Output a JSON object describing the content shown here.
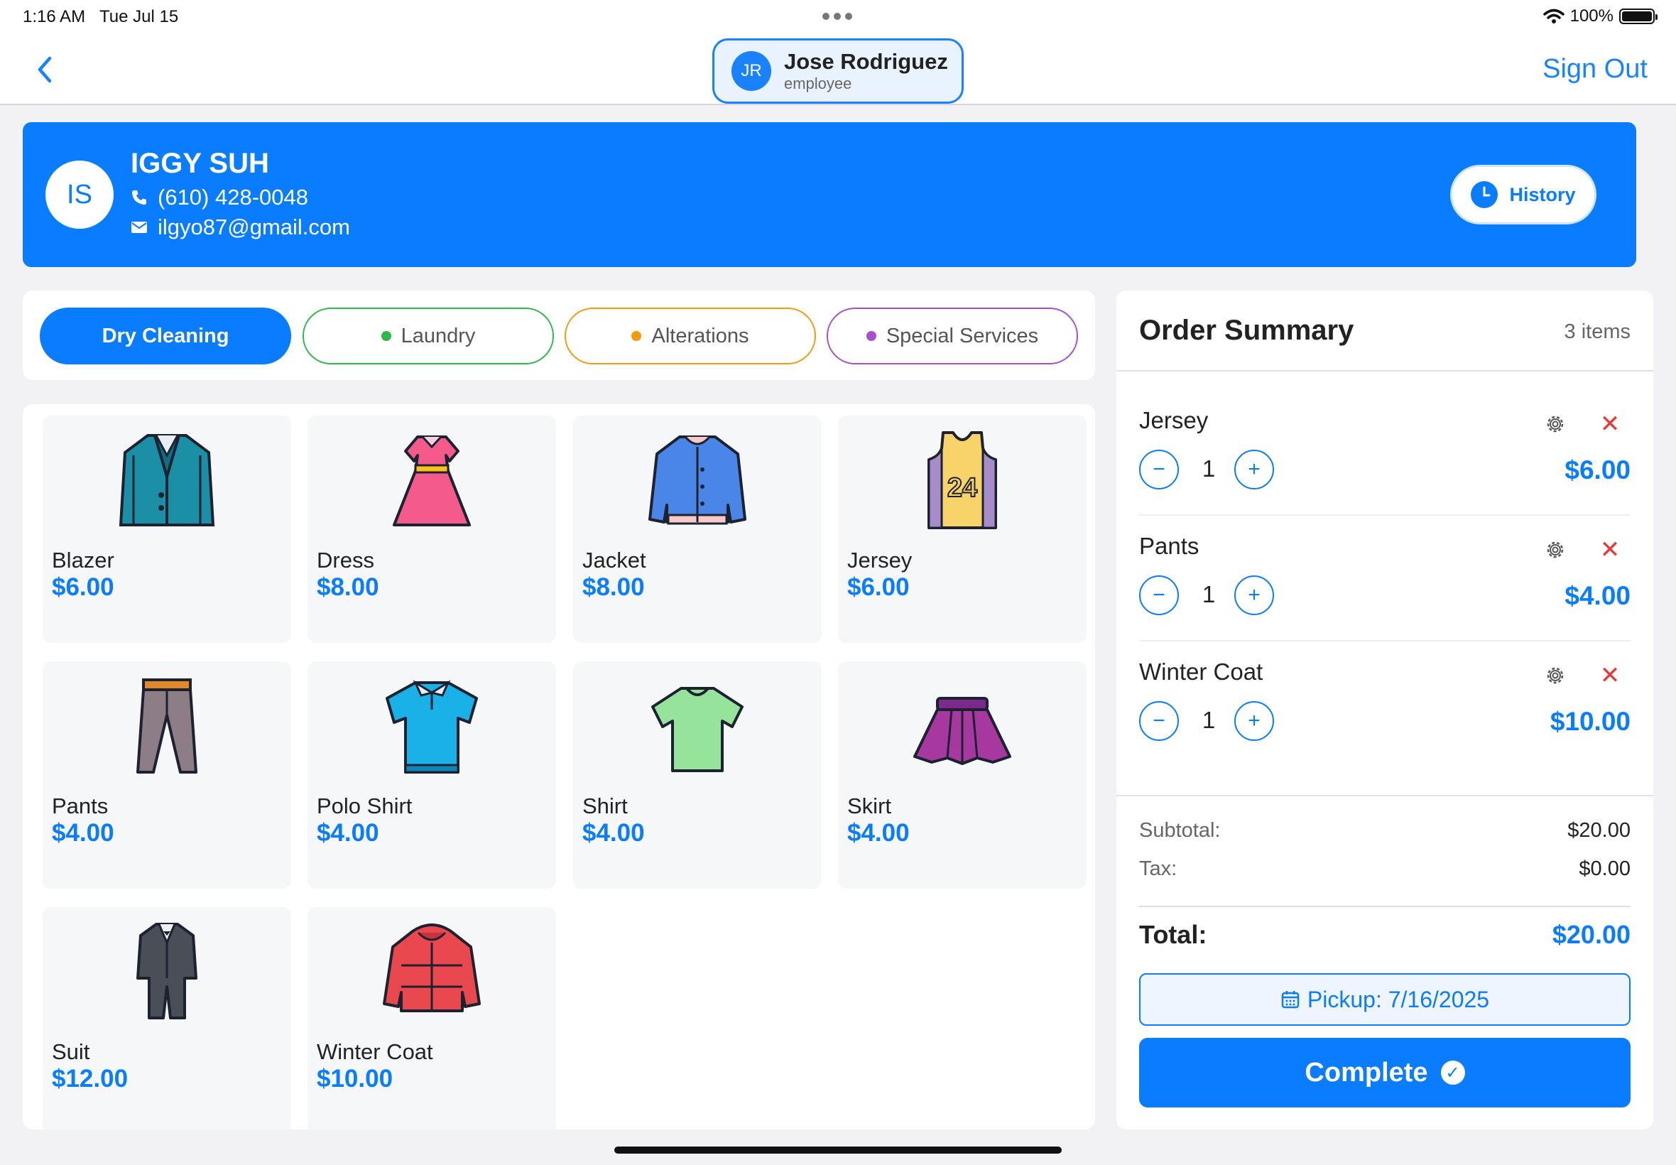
{
  "status_bar": {
    "time": "1:16 AM",
    "date": "Tue Jul 15",
    "battery": "100%"
  },
  "nav": {
    "employee_initials": "JR",
    "employee_name": "Jose Rodriguez",
    "employee_role": "employee",
    "sign_out": "Sign Out"
  },
  "customer": {
    "initials": "IS",
    "name": "IGGY SUH",
    "phone": "(610) 428-0048",
    "email": "ilgyo87@gmail.com",
    "history_label": "History"
  },
  "tabs": [
    {
      "label": "Dry Cleaning",
      "color": "#0a7cff",
      "active": true
    },
    {
      "label": "Laundry",
      "color": "#2fb84a",
      "active": false
    },
    {
      "label": "Alterations",
      "color": "#f59a0c",
      "active": false
    },
    {
      "label": "Special Services",
      "color": "#a64fcf",
      "active": false
    }
  ],
  "items": [
    {
      "name": "Blazer",
      "price": "$6.00",
      "icon": "blazer-icon"
    },
    {
      "name": "Dress",
      "price": "$8.00",
      "icon": "dress-icon"
    },
    {
      "name": "Jacket",
      "price": "$8.00",
      "icon": "jacket-icon"
    },
    {
      "name": "Jersey",
      "price": "$6.00",
      "icon": "jersey-icon"
    },
    {
      "name": "Pants",
      "price": "$4.00",
      "icon": "pants-icon"
    },
    {
      "name": "Polo Shirt",
      "price": "$4.00",
      "icon": "polo-shirt-icon"
    },
    {
      "name": "Shirt",
      "price": "$4.00",
      "icon": "shirt-icon"
    },
    {
      "name": "Skirt",
      "price": "$4.00",
      "icon": "skirt-icon"
    },
    {
      "name": "Suit",
      "price": "$12.00",
      "icon": "suit-icon"
    },
    {
      "name": "Winter Coat",
      "price": "$10.00",
      "icon": "winter-coat-icon"
    }
  ],
  "order": {
    "title": "Order Summary",
    "count": "3 items",
    "lines": [
      {
        "name": "Jersey",
        "qty": "1",
        "price": "$6.00"
      },
      {
        "name": "Pants",
        "qty": "1",
        "price": "$4.00"
      },
      {
        "name": "Winter Coat",
        "qty": "1",
        "price": "$10.00"
      }
    ],
    "subtotal_label": "Subtotal:",
    "subtotal": "$20.00",
    "tax_label": "Tax:",
    "tax": "$0.00",
    "total_label": "Total:",
    "total": "$20.00",
    "pickup_label": "Pickup: 7/16/2025",
    "complete_label": "Complete"
  },
  "colors": {
    "accent": "#0a7cff",
    "remove": "#e53935"
  }
}
